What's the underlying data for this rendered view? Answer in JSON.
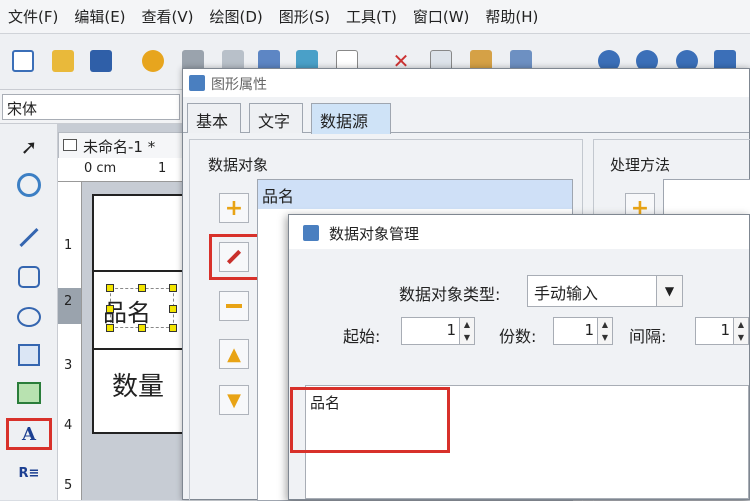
{
  "menu": [
    "文件(F)",
    "编辑(E)",
    "查看(V)",
    "绘图(D)",
    "图形(S)",
    "工具(T)",
    "窗口(W)",
    "帮助(H)"
  ],
  "font_name": "宋体",
  "document": {
    "tab_title": "未命名-1 *",
    "ruler_unit": "0 cm",
    "ruler_h_ticks": [
      "1"
    ],
    "ruler_v_ticks": [
      "1",
      "2",
      "3",
      "4",
      "5"
    ],
    "label_text_1": "品名",
    "label_text_2": "数量"
  },
  "shape_props_dialog": {
    "title": "图形属性",
    "tabs": [
      "基本",
      "文字",
      "数据源"
    ],
    "active_tab": "数据源",
    "data_object_group": "数据对象",
    "data_object_items": [
      "品名"
    ],
    "processing_group": "处理方法"
  },
  "data_object_dialog": {
    "title": "数据对象管理",
    "type_label": "数据对象类型:",
    "type_value": "手动输入",
    "start_label": "起始:",
    "start_value": "1",
    "copies_label": "份数:",
    "copies_value": "1",
    "interval_label": "间隔:",
    "interval_value": "1",
    "content_text": "品名"
  },
  "colors": {
    "highlight": "#d8312a",
    "selection_handle": "#f3e500",
    "list_selected": "#cfe0f7"
  }
}
